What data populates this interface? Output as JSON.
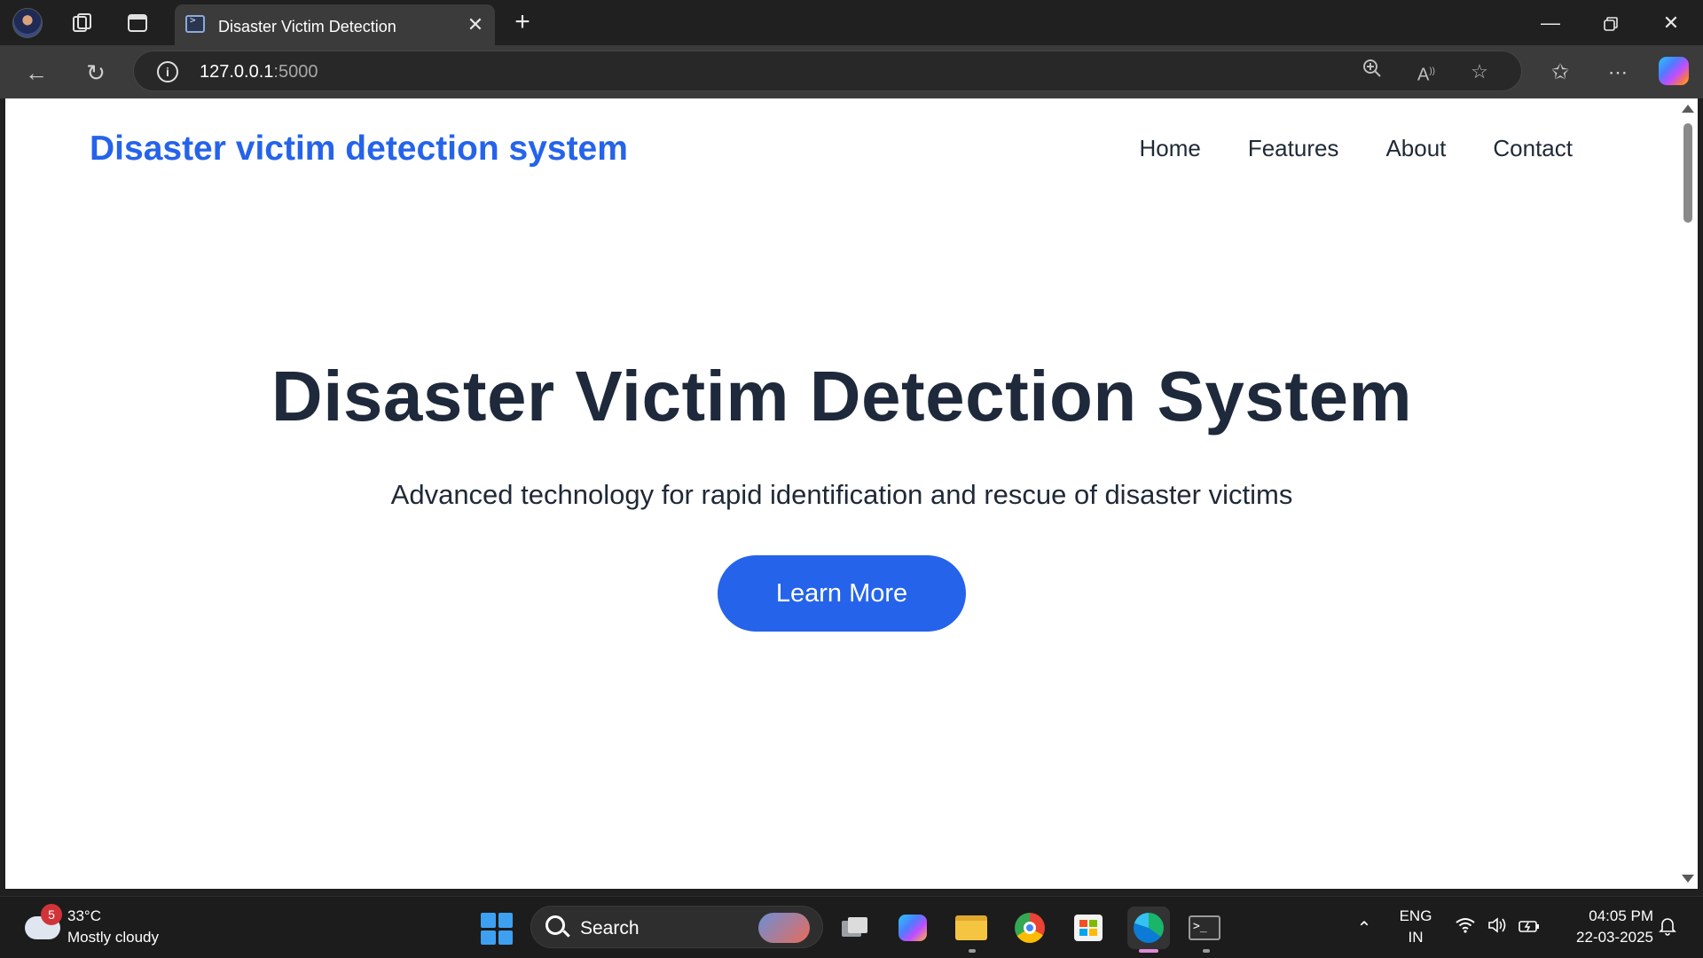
{
  "browser": {
    "tab_title": "Disaster Victim Detection",
    "url_host": "127.0.0.1",
    "url_port": ":5000"
  },
  "site": {
    "brand": "Disaster victim detection system",
    "nav": [
      "Home",
      "Features",
      "About",
      "Contact"
    ],
    "hero_title": "Disaster Victim Detection System",
    "hero_subtitle": "Advanced technology for rapid identification and rescue of disaster victims",
    "cta_label": "Learn More"
  },
  "taskbar": {
    "weather_badge": "5",
    "weather_temp": "33°C",
    "weather_desc": "Mostly cloudy",
    "search_label": "Search",
    "lang_top": "ENG",
    "lang_bottom": "IN",
    "time": "04:05 PM",
    "date": "22-03-2025"
  },
  "colors": {
    "brand": "#2563eb",
    "heading": "#1e293b",
    "cta": "#2563eb"
  },
  "icons": {
    "browser": [
      "profile-avatar-icon",
      "workspaces-icon",
      "tab-actions-icon",
      "back-icon",
      "refresh-icon",
      "site-info-icon",
      "zoom-icon",
      "read-aloud-icon",
      "favorite-star-icon",
      "favorites-icon",
      "more-icon",
      "copilot-icon"
    ],
    "taskbar": [
      "weather-icon",
      "windows-start-icon",
      "search-icon",
      "task-view-icon",
      "copilot-icon",
      "file-explorer-icon",
      "chrome-icon",
      "store-icon",
      "edge-icon",
      "terminal-icon",
      "wifi-icon",
      "volume-icon",
      "battery-icon",
      "notifications-icon"
    ]
  }
}
